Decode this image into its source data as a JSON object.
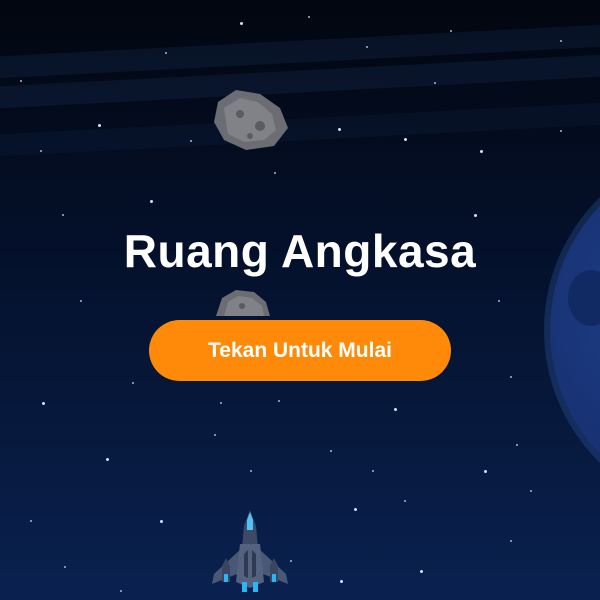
{
  "game": {
    "title": "Ruang Angkasa",
    "start_button_label": "Tekan Untuk Mulai"
  },
  "colors": {
    "background": "#050b1c",
    "accent": "#ff8a0a",
    "title_text": "#ffffff",
    "planet": "#173170"
  },
  "sprites": {
    "player": "spaceship-icon",
    "obstacle": "asteroid-icon",
    "backdrop": "planet"
  }
}
